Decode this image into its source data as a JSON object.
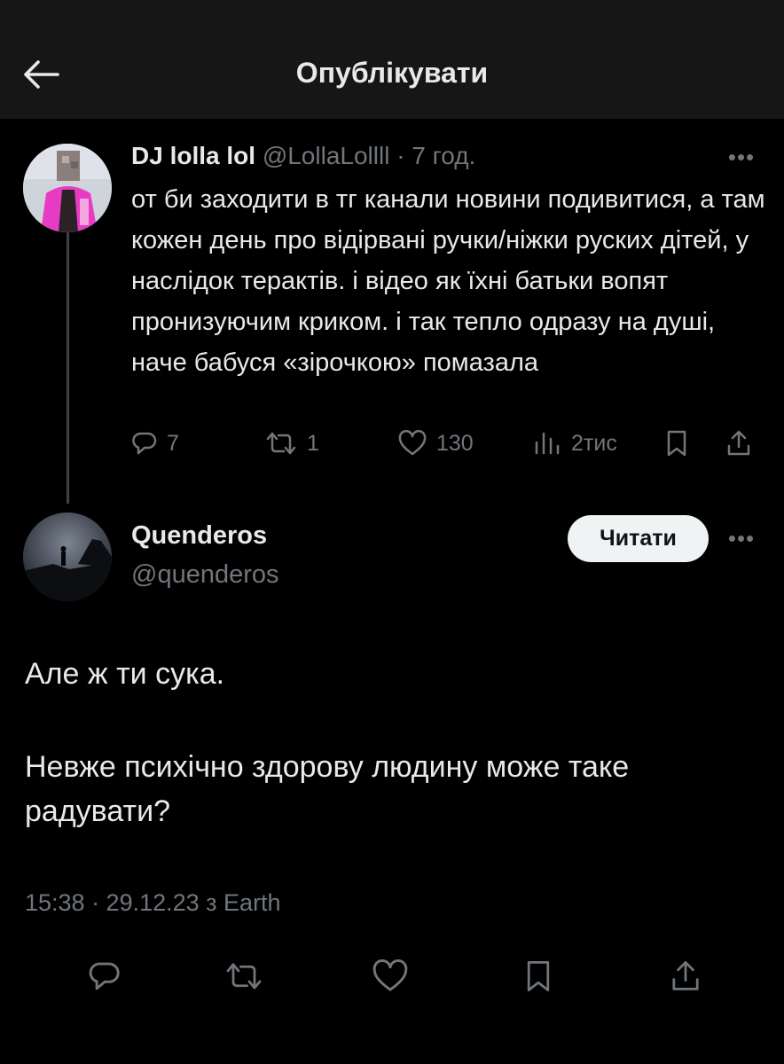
{
  "header": {
    "title": "Опублікувати",
    "back_icon": "arrow-left-icon"
  },
  "quoted_tweet": {
    "display_name": "DJ lolla lol",
    "handle": "@LollaLollll",
    "separator": "·",
    "time": "7 год.",
    "text": "от би заходити в тг канали новини подивитися, а там кожен день про відірвані ручки/ніжки руских дітей, у наслідок терактів. і відео як їхні батьки вопят пронизуючим криком. і так тепло одразу на душі, наче бабуся «зірочкою» помазала",
    "stats": {
      "replies": "7",
      "reposts": "1",
      "likes": "130",
      "views": "2тис"
    }
  },
  "main_tweet": {
    "display_name": "Quenderos",
    "handle": "@quenderos",
    "follow_label": "Читати",
    "paragraphs": [
      "Але ж ти сука.",
      "Невже психічно здорову людину може таке радувати?"
    ],
    "meta": "15:38 · 29.12.23 з Earth"
  },
  "colors": {
    "background": "#000000",
    "header_bg": "#161616",
    "text_primary": "#e7e9ea",
    "text_muted": "#71767b",
    "follow_bg": "#eff3f4"
  }
}
